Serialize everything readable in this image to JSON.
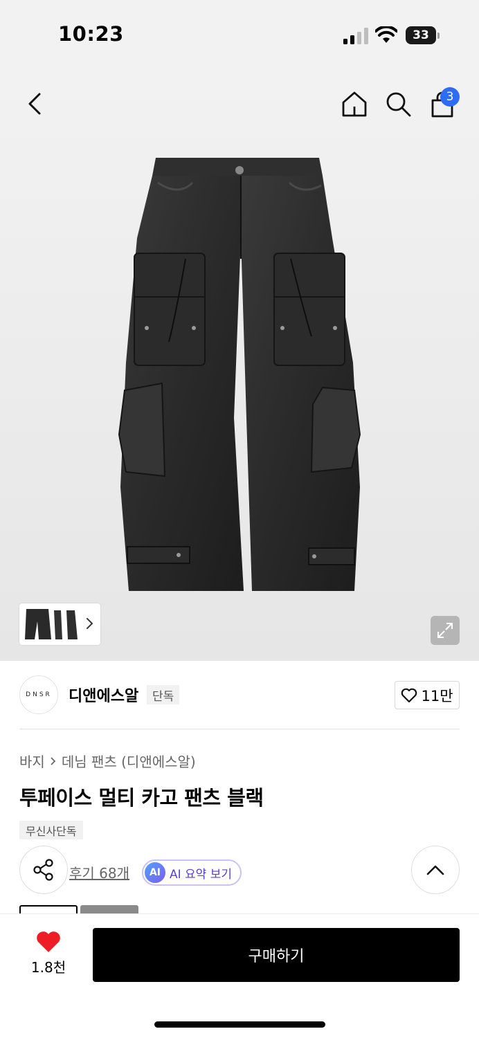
{
  "status_bar": {
    "time": "10:23",
    "battery": "33"
  },
  "header": {
    "cart_count": "3",
    "icons": [
      "back-icon",
      "home-icon",
      "search-icon",
      "shopping-bag-icon"
    ]
  },
  "brand": {
    "logo_text": "DNSR",
    "name": "디앤에스알",
    "tag": "단독",
    "likes": "11만"
  },
  "breadcrumb": {
    "category": "바지",
    "sub_category": "데님 팬츠 (디앤에스알)"
  },
  "product": {
    "title": "투페이스 멀티 카고 팬츠 블랙",
    "tag": "무신사단독"
  },
  "actions": {
    "reviews": "후기 68개",
    "ai_badge": "AI",
    "ai_summary": "AI 요약 보기"
  },
  "bottom": {
    "favorite_count": "1.8천",
    "buy_label": "구매하기"
  },
  "colors": {
    "accent_blue": "#2d6cf5",
    "heart_red": "#ee1c25",
    "ai_purple": "#5a3fd0"
  }
}
